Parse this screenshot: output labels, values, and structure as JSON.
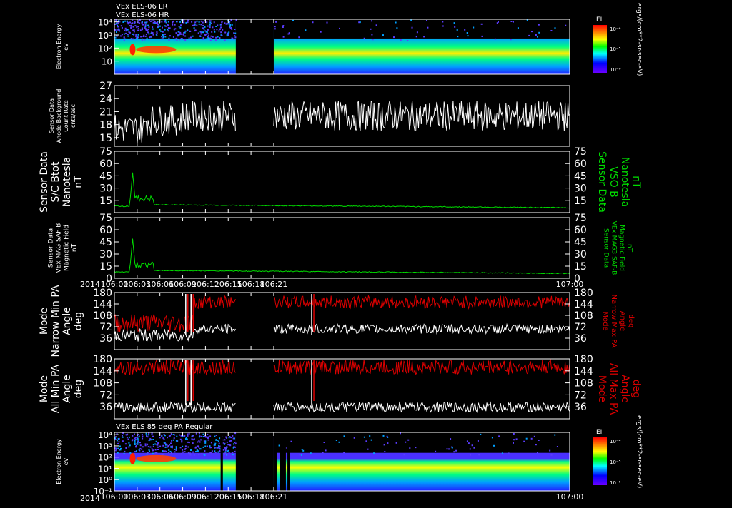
{
  "headers": {
    "top_line1": "VEx ELS-06 LR",
    "top_line2": "VEx ELS-06 HR",
    "bottom": "VEx ELS 85 deg PA Regular"
  },
  "year_label": "2014",
  "time_ticks": [
    "106:00",
    "106:03",
    "106:06",
    "106:09",
    "106:12",
    "106:15",
    "106:18",
    "106:21",
    "107:00"
  ],
  "colorbar": {
    "title": "EI",
    "units": "ergs/(cm**2-sr-sec-eV)",
    "ticks": [
      "10⁻⁴",
      "10⁻⁵",
      "10⁻⁶"
    ]
  },
  "chart_data": [
    {
      "type": "heatmap",
      "name": "panel-1",
      "ylabel_left": [
        "Electron Energy",
        "eV"
      ],
      "yticks": [
        "10⁴",
        "10³",
        "10²",
        "10"
      ],
      "ylog_range": [
        0,
        4.2
      ],
      "data_gap": [
        "106:16",
        "106:21"
      ]
    },
    {
      "type": "line",
      "name": "panel-2",
      "ylabel_left": [
        "Sensor Data",
        "Anode Background",
        "Count Rate",
        "cnts/sec"
      ],
      "yticks": [
        15,
        18,
        21,
        24,
        27
      ],
      "ylim": [
        13,
        27
      ],
      "series": [
        {
          "color": "#ffffff",
          "baseline": 18,
          "noise": 3,
          "segments": [
            [
              "106:00",
              "106:16"
            ],
            [
              "106:21",
              "107:00"
            ]
          ]
        }
      ],
      "data_gap": [
        "106:16",
        "106:21"
      ]
    },
    {
      "type": "line",
      "name": "panel-3",
      "ylabel_left": [
        "Sensor Data",
        "S/C Btot",
        "Nanotesla",
        "nT"
      ],
      "ylabel_right": [
        "Sensor Data",
        "VSO B",
        "Nanotesla",
        "nT"
      ],
      "yticks": [
        15,
        30,
        45,
        60,
        75
      ],
      "ylim": [
        0,
        75
      ],
      "series": [
        {
          "color": "#00dd00",
          "baseline": 8,
          "spike_time": "106:02.4",
          "spike_value": 49
        }
      ]
    },
    {
      "type": "line",
      "name": "panel-4",
      "ylabel_left": [
        "Sensor Data",
        "VEx MAG SAF-B",
        "Magnetic Field",
        "nT"
      ],
      "ylabel_right": [
        "Sensor Data",
        "VEx MAG3 SAF-B",
        "Magnetic Field",
        "nT"
      ],
      "yticks": [
        0,
        15,
        30,
        45,
        60,
        75
      ],
      "ylim": [
        0,
        75
      ],
      "series": [
        {
          "color": "#00dd00",
          "baseline": 8,
          "spike_time": "106:02.4",
          "spike_value": 49
        }
      ]
    },
    {
      "type": "line",
      "name": "panel-5",
      "ylabel_left": [
        "Mode",
        "Narrow Min PA",
        "Angle",
        "deg"
      ],
      "ylabel_right": [
        "Mode",
        "Narrow Max PA",
        "Angle",
        "deg"
      ],
      "yticks": [
        36,
        72,
        108,
        144,
        180
      ],
      "ylim": [
        0,
        180
      ],
      "series": [
        {
          "color": "#dd0000",
          "description": "max PA"
        },
        {
          "color": "#ffffff",
          "description": "min PA"
        }
      ],
      "data_gap": [
        "106:16",
        "106:21"
      ]
    },
    {
      "type": "line",
      "name": "panel-6",
      "ylabel_left": [
        "Mode",
        "All Min PA",
        "Angle",
        "deg"
      ],
      "ylabel_right": [
        "Mode",
        "All Max PA",
        "Angle",
        "deg"
      ],
      "yticks": [
        36,
        72,
        108,
        144,
        180
      ],
      "ylim": [
        0,
        180
      ],
      "series": [
        {
          "color": "#dd0000",
          "description": "max PA"
        },
        {
          "color": "#ffffff",
          "description": "min PA"
        }
      ],
      "data_gap": [
        "106:16",
        "106:21"
      ]
    },
    {
      "type": "heatmap",
      "name": "panel-7",
      "ylabel_left": [
        "Electron Energy",
        "eV"
      ],
      "yticks": [
        "10⁴",
        "10³",
        "10²",
        "10¹",
        "10⁰",
        "10⁻¹"
      ],
      "ylog_range": [
        -1,
        4.2
      ],
      "data_gap": [
        "106:16",
        "106:21"
      ]
    }
  ]
}
